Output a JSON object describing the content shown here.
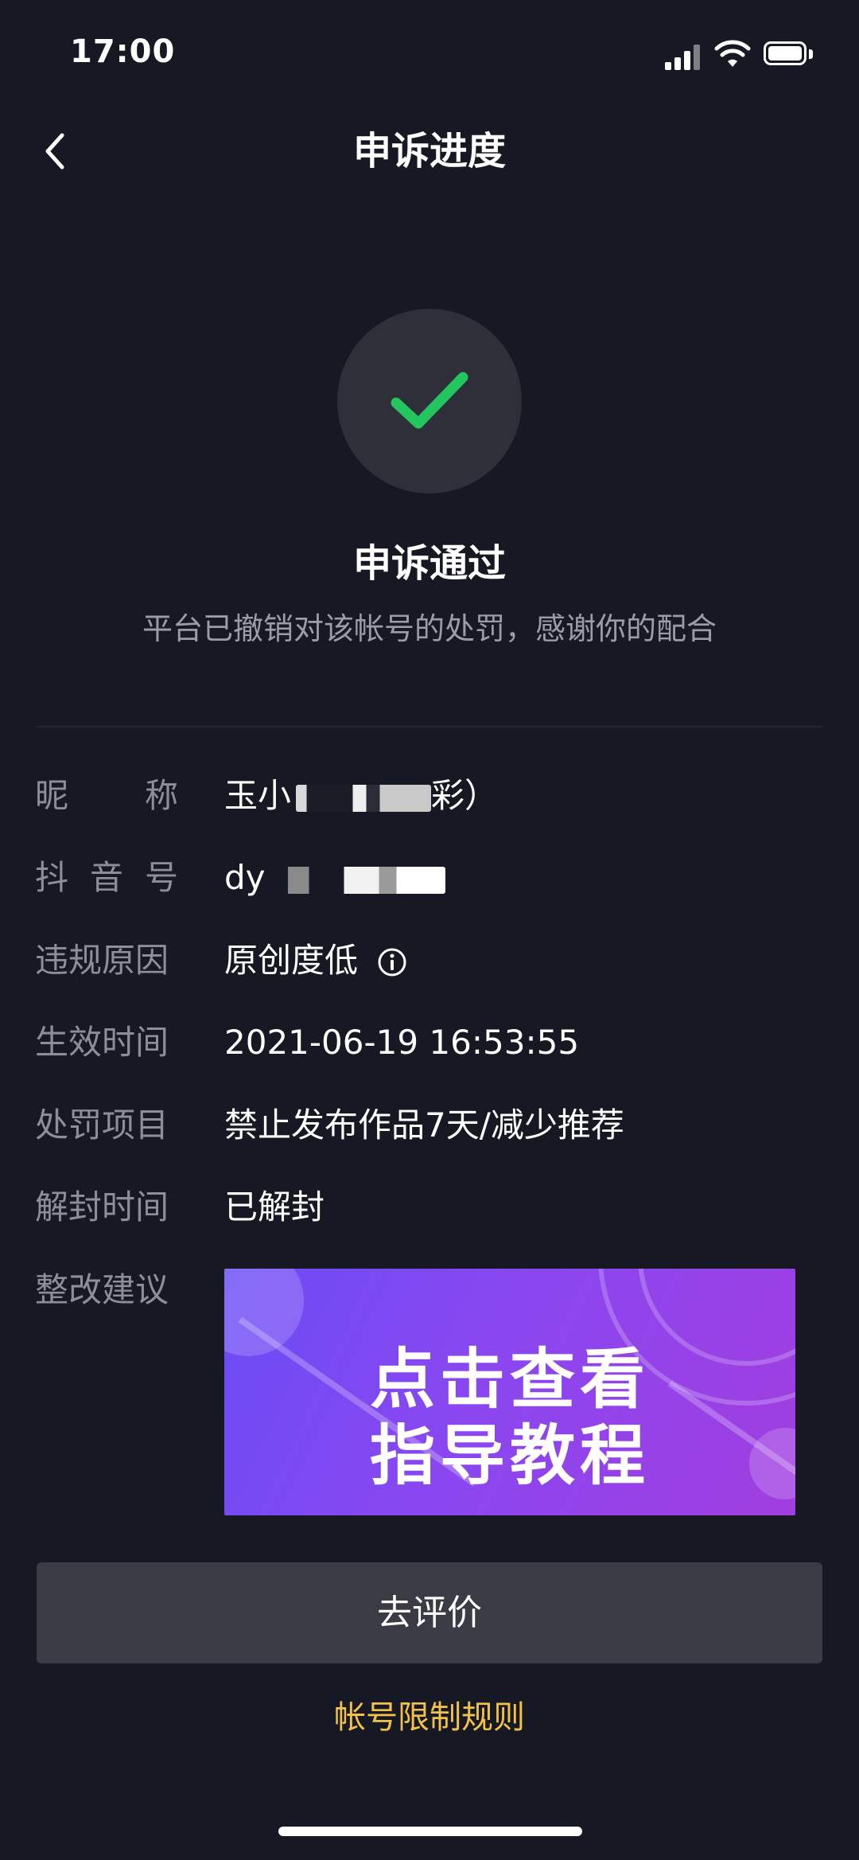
{
  "status_bar": {
    "time": "17:00"
  },
  "nav": {
    "title": "申诉进度"
  },
  "result": {
    "title": "申诉通过",
    "description": "平台已撤销对该帐号的处罚，感谢你的配合",
    "accent_color": "#22c55e"
  },
  "info": {
    "nickname": {
      "label_chars": [
        "昵",
        "称"
      ],
      "value": "玉小",
      "value_tail": "彩）"
    },
    "douyin_id": {
      "label_chars": [
        "抖",
        "音",
        "号"
      ],
      "value": "dy"
    },
    "violation_reason": {
      "label": "违规原因",
      "value": "原创度低"
    },
    "effective_time": {
      "label": "生效时间",
      "value": "2021-06-19 16:53:55"
    },
    "penalty": {
      "label": "处罚项目",
      "value": "禁止发布作品7天/减少推荐"
    },
    "unban_time": {
      "label": "解封时间",
      "value": "已解封"
    },
    "suggestion": {
      "label": "整改建议",
      "banner_line1": "点击查看",
      "banner_line2": "指导教程"
    }
  },
  "actions": {
    "rate_label": "去评价",
    "rules_link": "帐号限制规则",
    "rules_link_color": "#f2c14a"
  }
}
